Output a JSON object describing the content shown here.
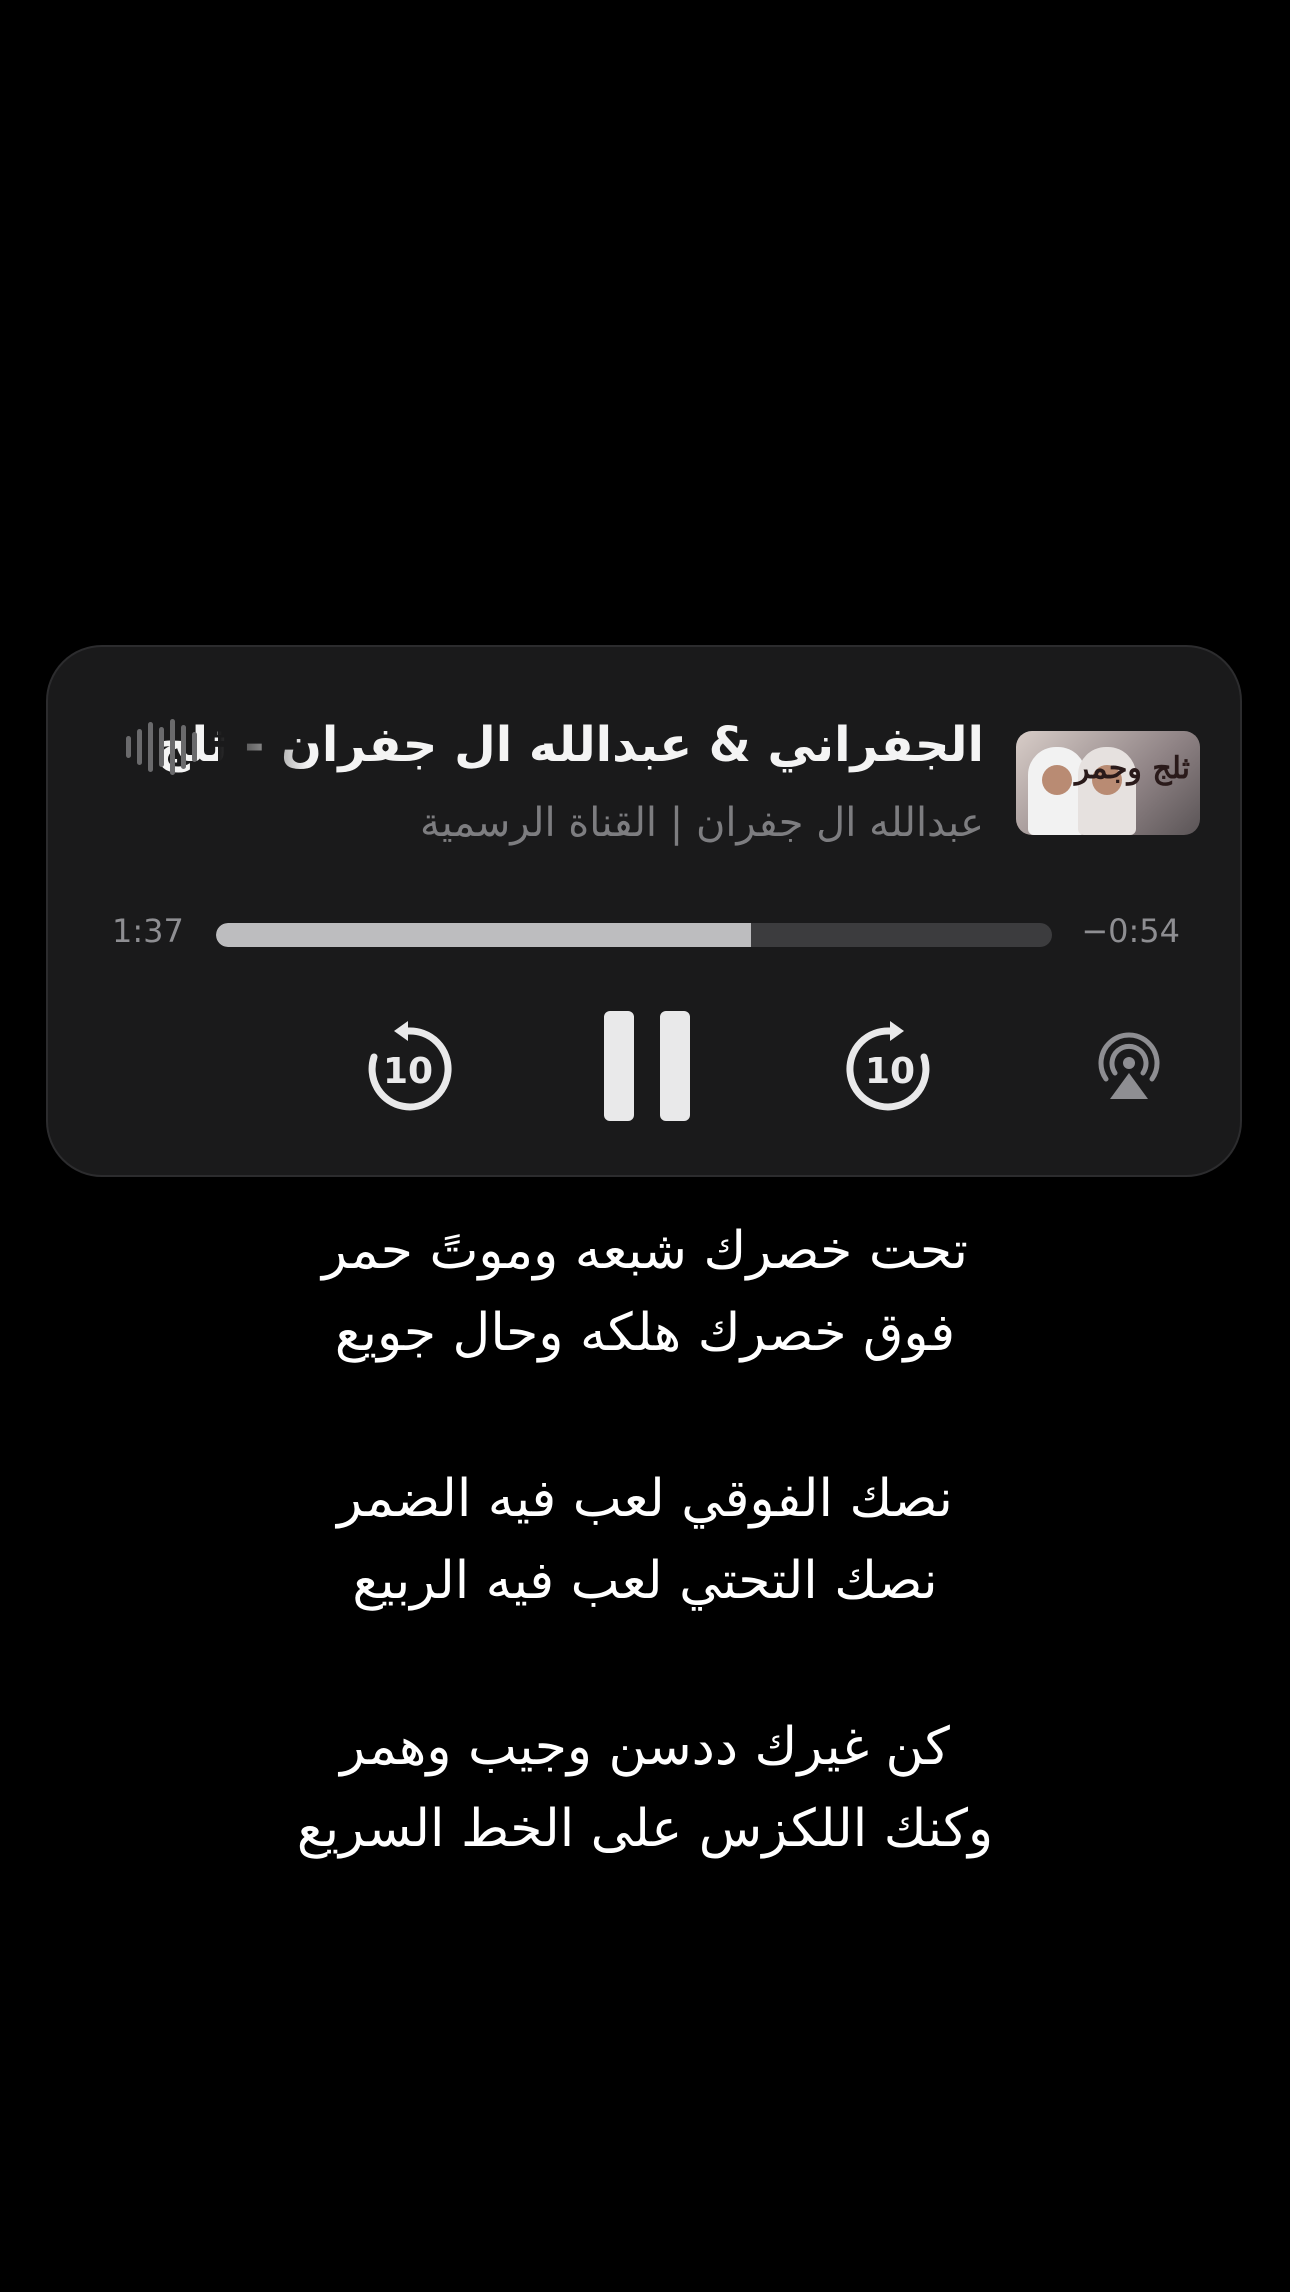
{
  "player": {
    "title": "الجفراني & عبدالله ال جفران - ثلج",
    "artist": "عبدالله ال جفران | القناة الرسمية",
    "artwork_icon": "album-artwork",
    "artwork_text": "ثلج وجمر",
    "elapsed": "1:37",
    "remaining": "−0:54",
    "progress_fraction": 0.64,
    "skip_back_seconds": "10",
    "skip_forward_seconds": "10",
    "pause_icon": "pause-icon",
    "airplay_icon": "airplay-icon",
    "accent_color": "#e9e9ea"
  },
  "lyrics": {
    "stanzas": [
      [
        "تحت خصرك شبعه وموتً حمر",
        "فوق خصرك هلكه وحال جويع"
      ],
      [
        "نصك الفوقي لعب فيه الضمر",
        "نصك التحتي لعب فيه الربيع"
      ],
      [
        "كن غيرك ددسن وجيب وهمر",
        "وكنك اللكزس على الخط السريع"
      ]
    ]
  }
}
